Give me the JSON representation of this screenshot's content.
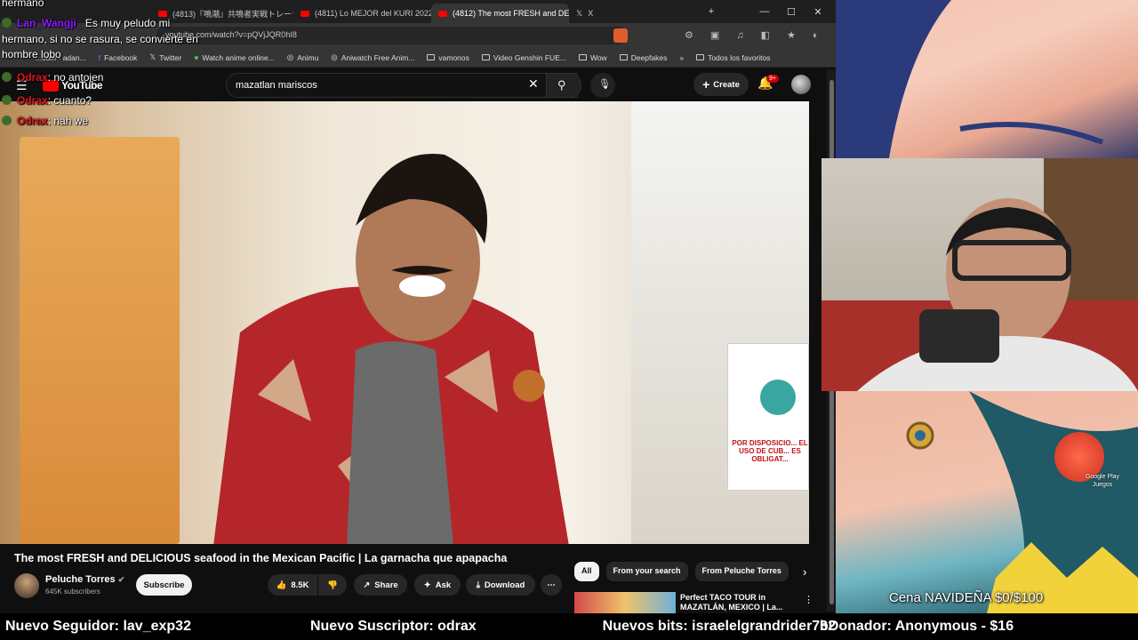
{
  "browser": {
    "tabs": [
      {
        "label": "(4813)『鳴潮』共鳴者実戦トレーラー | ..."
      },
      {
        "label": "(4811) Lo MEJOR del KURI 2022 - Y..."
      },
      {
        "label": "(4812) The most FRESH and DE..."
      },
      {
        "label": "X"
      }
    ],
    "url": "youtube.com/watch?v=pQVjJQR0hI8",
    "bookmarks": [
      "...com - adan...",
      "Facebook",
      "Twitter",
      "Watch anime online...",
      "Animu",
      "Aniwatch Free Anim...",
      "vamonos",
      "Video Genshin FUE...",
      "Wow",
      "Deepfakes",
      "Todos los favoritos"
    ]
  },
  "youtube": {
    "logo": "YouTube",
    "search_value": "mazatlan mariscos",
    "create_label": "Create",
    "notif_badge": "9+",
    "video": {
      "title": "The most FRESH and DELICIOUS seafood in the Mexican Pacific | La garnacha que apapacha",
      "channel": "Peluche Torres",
      "subscribers": "645K subscribers",
      "subscribe_label": "Subscribe",
      "likes": "8.5K",
      "share_label": "Share",
      "ask_label": "Ask",
      "download_label": "Download",
      "sign_text": "POR DISPOSICIO... EL USO DE CUB... ES OBLIGAT..."
    },
    "chips": [
      "All",
      "From your search",
      "From Peluche Torres"
    ],
    "recommended": {
      "title": "Perfect TACO TOUR in MAZATLÁN, MEXICO | La..."
    }
  },
  "chat": [
    {
      "name": "",
      "text": "hermano"
    },
    {
      "name": "Lan_Wangji_",
      "text": "Es muy peludo mi"
    },
    {
      "name": "",
      "text": "hermano, si no se rasura, se convierte en"
    },
    {
      "name": "",
      "text": "hombre lobo"
    },
    {
      "name": "Odrax",
      "text": "no antojen"
    },
    {
      "name": "Odrax",
      "text": "cuanto?"
    },
    {
      "name": "Odrax",
      "text": "nah we"
    }
  ],
  "overlay": {
    "goal": "Cena NAVIDEÑA $0/$100",
    "google_play": "Google Play Juegos"
  },
  "ticker": [
    "Nuevo Seguidor: lav_exp32",
    "Nuevo Suscriptor: odrax",
    "Nuevos bits: israelelgrandrider732",
    "bDonador: Anonymous - $16"
  ],
  "colors": {
    "youtube_red": "#ff0000",
    "chat_name": "#e0141e",
    "ticker_bg": "#000000"
  }
}
